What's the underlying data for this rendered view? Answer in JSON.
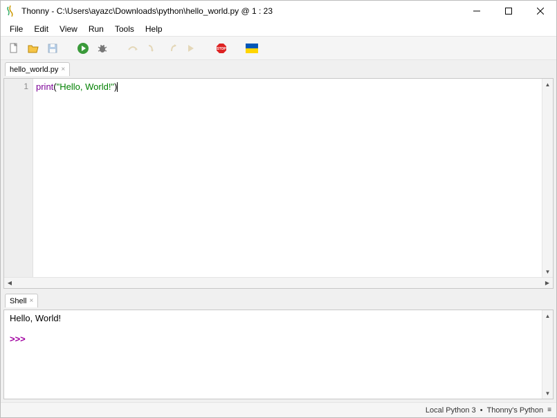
{
  "titlebar": {
    "title": "Thonny  -  C:\\Users\\ayazc\\Downloads\\python\\hello_world.py  @  1 : 23"
  },
  "menubar": {
    "items": [
      "File",
      "Edit",
      "View",
      "Run",
      "Tools",
      "Help"
    ]
  },
  "toolbar": {
    "icons": {
      "new": "new-file-icon",
      "open": "open-folder-icon",
      "save": "save-icon",
      "run": "run-icon",
      "debug": "debug-icon",
      "step_over": "step-over-icon",
      "step_into": "step-into-icon",
      "step_out": "step-out-icon",
      "resume": "resume-icon",
      "stop": "stop-icon",
      "flag": "ukraine-flag-icon"
    }
  },
  "editor": {
    "tab_label": "hello_world.py",
    "tab_close": "×",
    "line_number": "1",
    "code": {
      "fn": "print",
      "open": "(",
      "str": "\"Hello, World!\"",
      "close": ")"
    }
  },
  "shell": {
    "tab_label": "Shell",
    "tab_close": "×",
    "output": "Hello, World!",
    "prompt": ">>> "
  },
  "statusbar": {
    "interpreter": "Local Python 3",
    "sep": "•",
    "backend": "Thonny's Python",
    "menu_glyph": "≡"
  }
}
